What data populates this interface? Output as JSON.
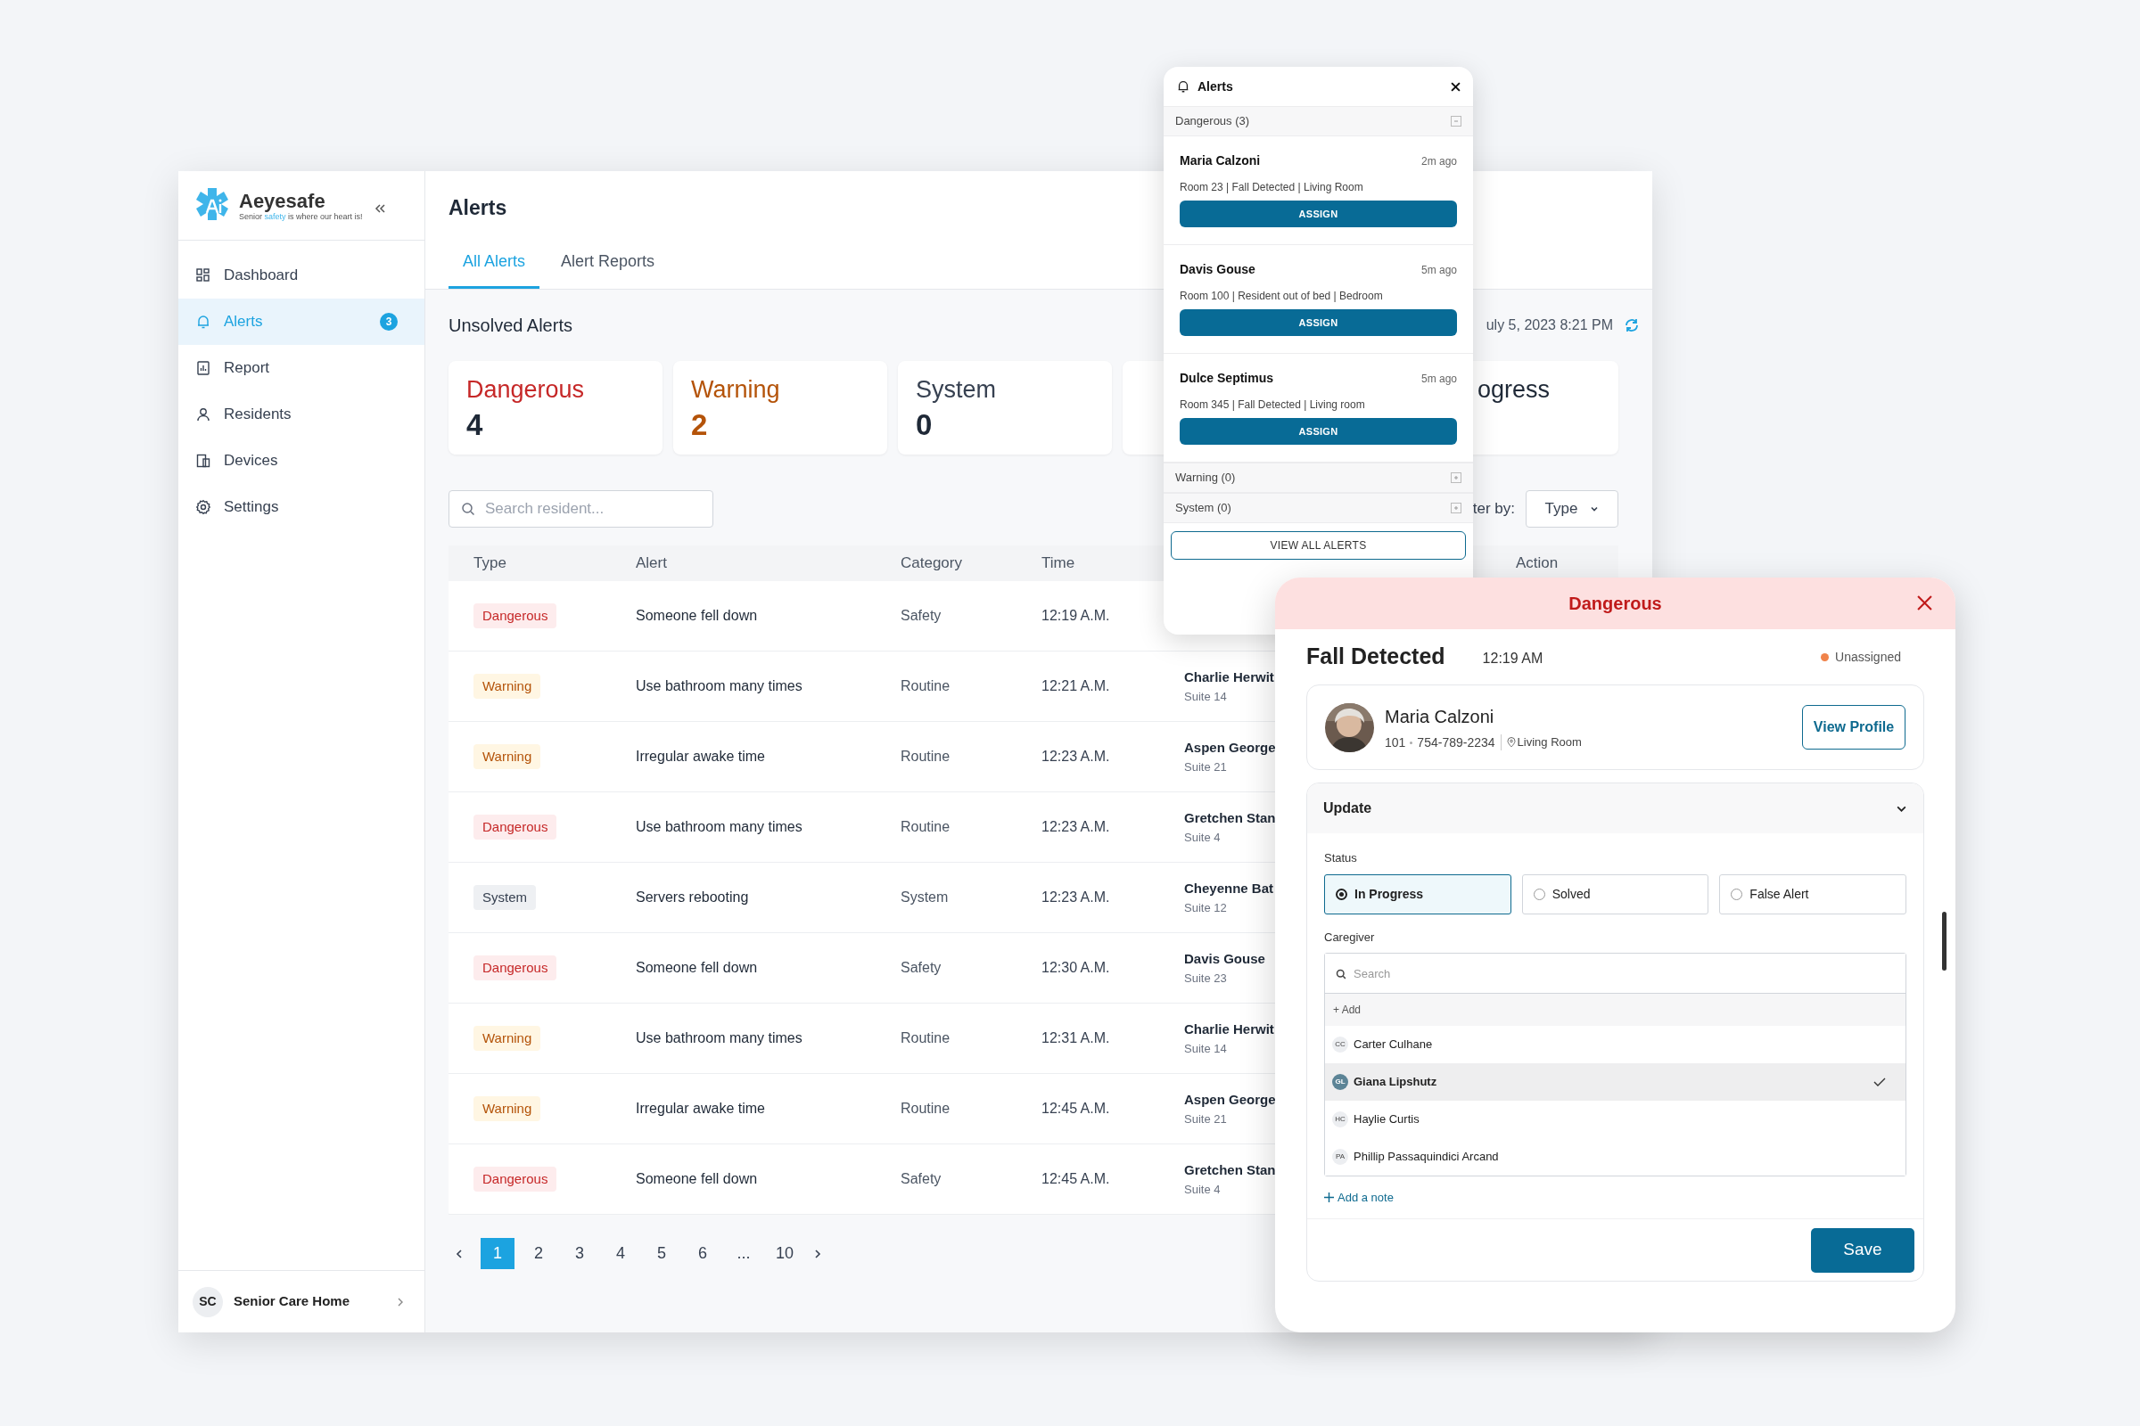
{
  "brand": {
    "name": "Aeyesafe",
    "tagline_before": "Senior ",
    "tagline_highlight": "safety",
    "tagline_after": " is where our heart is!"
  },
  "sidebar": {
    "items": [
      {
        "label": "Dashboard",
        "selected": false
      },
      {
        "label": "Alerts",
        "selected": true,
        "badge": "3"
      },
      {
        "label": "Report",
        "selected": false
      },
      {
        "label": "Residents",
        "selected": false
      },
      {
        "label": "Devices",
        "selected": false
      },
      {
        "label": "Settings",
        "selected": false
      }
    ],
    "footer": {
      "initials": "SC",
      "name": "Senior Care Home"
    }
  },
  "page": {
    "title": "Alerts",
    "tabs": [
      {
        "label": "All Alerts",
        "selected": true
      },
      {
        "label": "Alert Reports",
        "selected": false
      }
    ],
    "section_title": "Unsolved Alerts",
    "timestamp": "uly 5, 2023 8:21 PM",
    "stats": [
      {
        "kind": "dangerous",
        "label": "Dangerous",
        "value": "4"
      },
      {
        "kind": "warning",
        "label": "Warning",
        "value": "2"
      },
      {
        "kind": "system",
        "label": "System",
        "value": "0"
      },
      {
        "kind": "partial",
        "label": "ogress"
      }
    ],
    "search": {
      "placeholder": "Search resident..."
    },
    "filter": {
      "label": "ter by:",
      "value": "Type"
    }
  },
  "table": {
    "columns": [
      "Type",
      "Alert",
      "Category",
      "Time",
      "Action"
    ],
    "rows": [
      {
        "kind": "dangerous",
        "type": "Dangerous",
        "alert": "Someone fell down",
        "category": "Safety",
        "time": "12:19 A.M."
      },
      {
        "kind": "warning",
        "type": "Warning",
        "alert": "Use bathroom many times",
        "category": "Routine",
        "time": "12:21 A.M.",
        "resident": "Charlie Herwit",
        "suite": "Suite 14"
      },
      {
        "kind": "warning",
        "type": "Warning",
        "alert": "Irregular awake time",
        "category": "Routine",
        "time": "12:23 A.M.",
        "resident": "Aspen George",
        "suite": "Suite 21"
      },
      {
        "kind": "dangerous",
        "type": "Dangerous",
        "alert": "Use bathroom many times",
        "category": "Routine",
        "time": "12:23 A.M.",
        "resident": "Gretchen Stan",
        "suite": "Suite 4"
      },
      {
        "kind": "system",
        "type": "System",
        "alert": "Servers rebooting",
        "category": "System",
        "time": "12:23 A.M.",
        "resident": "Cheyenne Bat",
        "suite": "Suite 12"
      },
      {
        "kind": "dangerous",
        "type": "Dangerous",
        "alert": "Someone fell down",
        "category": "Safety",
        "time": "12:30 A.M.",
        "resident": "Davis Gouse",
        "suite": "Suite 23"
      },
      {
        "kind": "warning",
        "type": "Warning",
        "alert": "Use bathroom many times",
        "category": "Routine",
        "time": "12:31 A.M.",
        "resident": "Charlie Herwit",
        "suite": "Suite 14"
      },
      {
        "kind": "warning",
        "type": "Warning",
        "alert": "Irregular awake time",
        "category": "Routine",
        "time": "12:45 A.M.",
        "resident": "Aspen George",
        "suite": "Suite 21"
      },
      {
        "kind": "dangerous",
        "type": "Dangerous",
        "alert": "Someone fell down",
        "category": "Safety",
        "time": "12:45 A.M.",
        "resident": "Gretchen Stan",
        "suite": "Suite 4"
      }
    ]
  },
  "pagination": {
    "pages": [
      {
        "label": "1",
        "selected": true
      },
      {
        "label": "2",
        "selected": false
      },
      {
        "label": "3",
        "selected": false
      },
      {
        "label": "4",
        "selected": false
      },
      {
        "label": "5",
        "selected": false
      },
      {
        "label": "6",
        "selected": false
      },
      {
        "label": "...",
        "selected": false
      },
      {
        "label": "10",
        "selected": false
      }
    ]
  },
  "alerts_popup": {
    "title": "Alerts",
    "groups": [
      {
        "label": "Dangerous (3)",
        "expanded": true,
        "items": [
          {
            "name": "Maria Calzoni",
            "ago": "2m ago",
            "detail": "Room 23 | Fall Detected | Living Room",
            "button": "ASSIGN"
          },
          {
            "name": "Davis Gouse",
            "ago": "5m ago",
            "detail": "Room 100 | Resident out of bed | Bedroom",
            "button": "ASSIGN"
          },
          {
            "name": "Dulce Septimus",
            "ago": "5m ago",
            "detail": "Room 345 | Fall Detected | Living room",
            "button": "ASSIGN"
          }
        ]
      },
      {
        "label": "Warning (0)",
        "expanded": false
      },
      {
        "label": "System (0)",
        "expanded": false
      }
    ],
    "button": "VIEW ALL ALERTS"
  },
  "detail_modal": {
    "header": "Dangerous",
    "title": "Fall Detected",
    "time": "12:19 AM",
    "assignment": "Unassigned",
    "resident": {
      "name": "Maria Calzoni",
      "room": "101",
      "phone": "754-789-2234",
      "location": "Living Room",
      "button": "View Profile"
    },
    "update": {
      "title": "Update",
      "expanded": true,
      "status_label": "Status",
      "statuses": [
        {
          "label": "In Progress",
          "selected": true
        },
        {
          "label": "Solved",
          "selected": false
        },
        {
          "label": "False Alert",
          "selected": false
        }
      ],
      "caregiver_label": "Caregiver",
      "search_placeholder": "Search",
      "add_label": "+ Add",
      "caregivers": [
        {
          "initials": "CC",
          "name": "Carter Culhane",
          "selected": false
        },
        {
          "initials": "GL",
          "name": "Giana Lipshutz",
          "selected": true
        },
        {
          "initials": "HC",
          "name": "Haylie Curtis",
          "selected": false
        },
        {
          "initials": "PA",
          "name": "Phillip Passaquindici Arcand",
          "selected": false
        }
      ],
      "note_link": "Add a note"
    },
    "save": "Save"
  }
}
